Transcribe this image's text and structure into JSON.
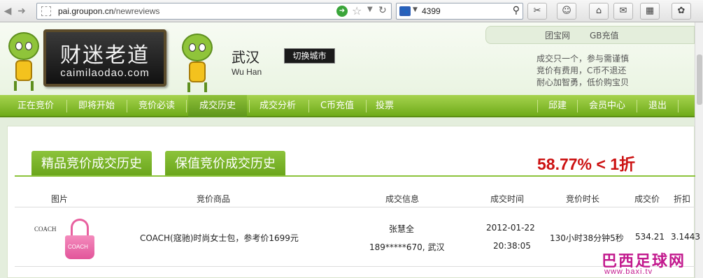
{
  "browser": {
    "url_prefix": "pai.groupon.cn",
    "url_path": "/newreviews",
    "search_text": "4399",
    "colors": {
      "go": "#3aa53a"
    }
  },
  "header": {
    "logo_cn": "财迷老道",
    "logo_en": "caimilaodao.com",
    "city_cn": "武汉",
    "city_en": "Wu Han",
    "switch_city": "切换城市",
    "top_links": [
      "团宝网",
      "GB充值"
    ],
    "slogan": [
      "成交只一个，参与需谨慎",
      "竞价有费用，C币不退还",
      "耐心加智勇，低价购宝贝"
    ]
  },
  "nav": {
    "items": [
      "正在竞价",
      "即将开始",
      "竞价必读",
      "成交历史",
      "成交分析",
      "C币充值",
      "投票"
    ],
    "active": "成交历史",
    "right_items": [
      "邱建",
      "会员中心",
      "退出"
    ]
  },
  "content": {
    "tabs": [
      "精品竞价成交历史",
      "保值竞价成交历史"
    ],
    "headline": "58.77%  <  1折",
    "columns": [
      "图片",
      "竞价商品",
      "成交信息",
      "成交时间",
      "竞价时长",
      "成交价",
      "折扣"
    ],
    "rows": [
      {
        "product": "COACH(寇驰)时尚女士包，参考价1699元",
        "winner": "张慧全",
        "winner_info": "189*****670, 武汉",
        "date": "2012-01-22",
        "time": "20:38:05",
        "duration": "130小时38分钟5秒",
        "price": "534.21",
        "discount": "3.1443",
        "image_brand": "COACH",
        "image_label": "COACH"
      }
    ]
  },
  "watermark": {
    "cn": "巴西足球网",
    "url": "www.baxi.tv"
  }
}
